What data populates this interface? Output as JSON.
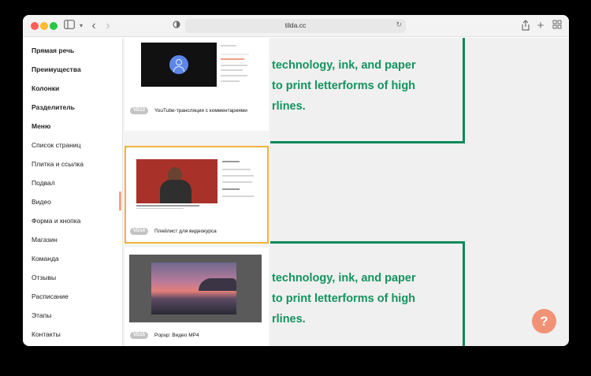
{
  "browser": {
    "url": "tilda.cc"
  },
  "left_nav": {
    "items": [
      {
        "label": "Прямая речь",
        "bold": true
      },
      {
        "label": "Преимущества",
        "bold": true
      },
      {
        "label": "Колонки",
        "bold": true
      },
      {
        "label": "Разделитель",
        "bold": true
      },
      {
        "label": "Меню",
        "bold": true
      },
      {
        "label": "Список страниц",
        "bold": false
      },
      {
        "label": "Плитка и ссылка",
        "bold": false
      },
      {
        "label": "Подвал",
        "bold": false
      },
      {
        "label": "Видео",
        "bold": false
      },
      {
        "label": "Форма и кнопка",
        "bold": false
      },
      {
        "label": "Магазин",
        "bold": false
      },
      {
        "label": "Команда",
        "bold": false
      },
      {
        "label": "Отзывы",
        "bold": false
      },
      {
        "label": "Расписание",
        "bold": false
      },
      {
        "label": "Этапы",
        "bold": false
      },
      {
        "label": "Контакты",
        "bold": false
      }
    ]
  },
  "blocks": [
    {
      "tag": "VD13",
      "title": "YouTube-трансляция с комментариями"
    },
    {
      "tag": "VD14",
      "title": "Плейлист для видеокурса"
    },
    {
      "tag": "VD15",
      "title": "Popup: Видео MP4"
    }
  ],
  "preview": {
    "top_lines": [
      "technology, ink, and paper",
      "to print letterforms of high",
      "rlines."
    ],
    "bottom_lines": [
      "technology, ink, and paper",
      "to print letterforms of high",
      "rlines."
    ]
  },
  "help": {
    "label": "?"
  },
  "colors": {
    "accent_green": "#14935f",
    "selection_outline": "#f2b23d",
    "help_button": "#f19277"
  }
}
